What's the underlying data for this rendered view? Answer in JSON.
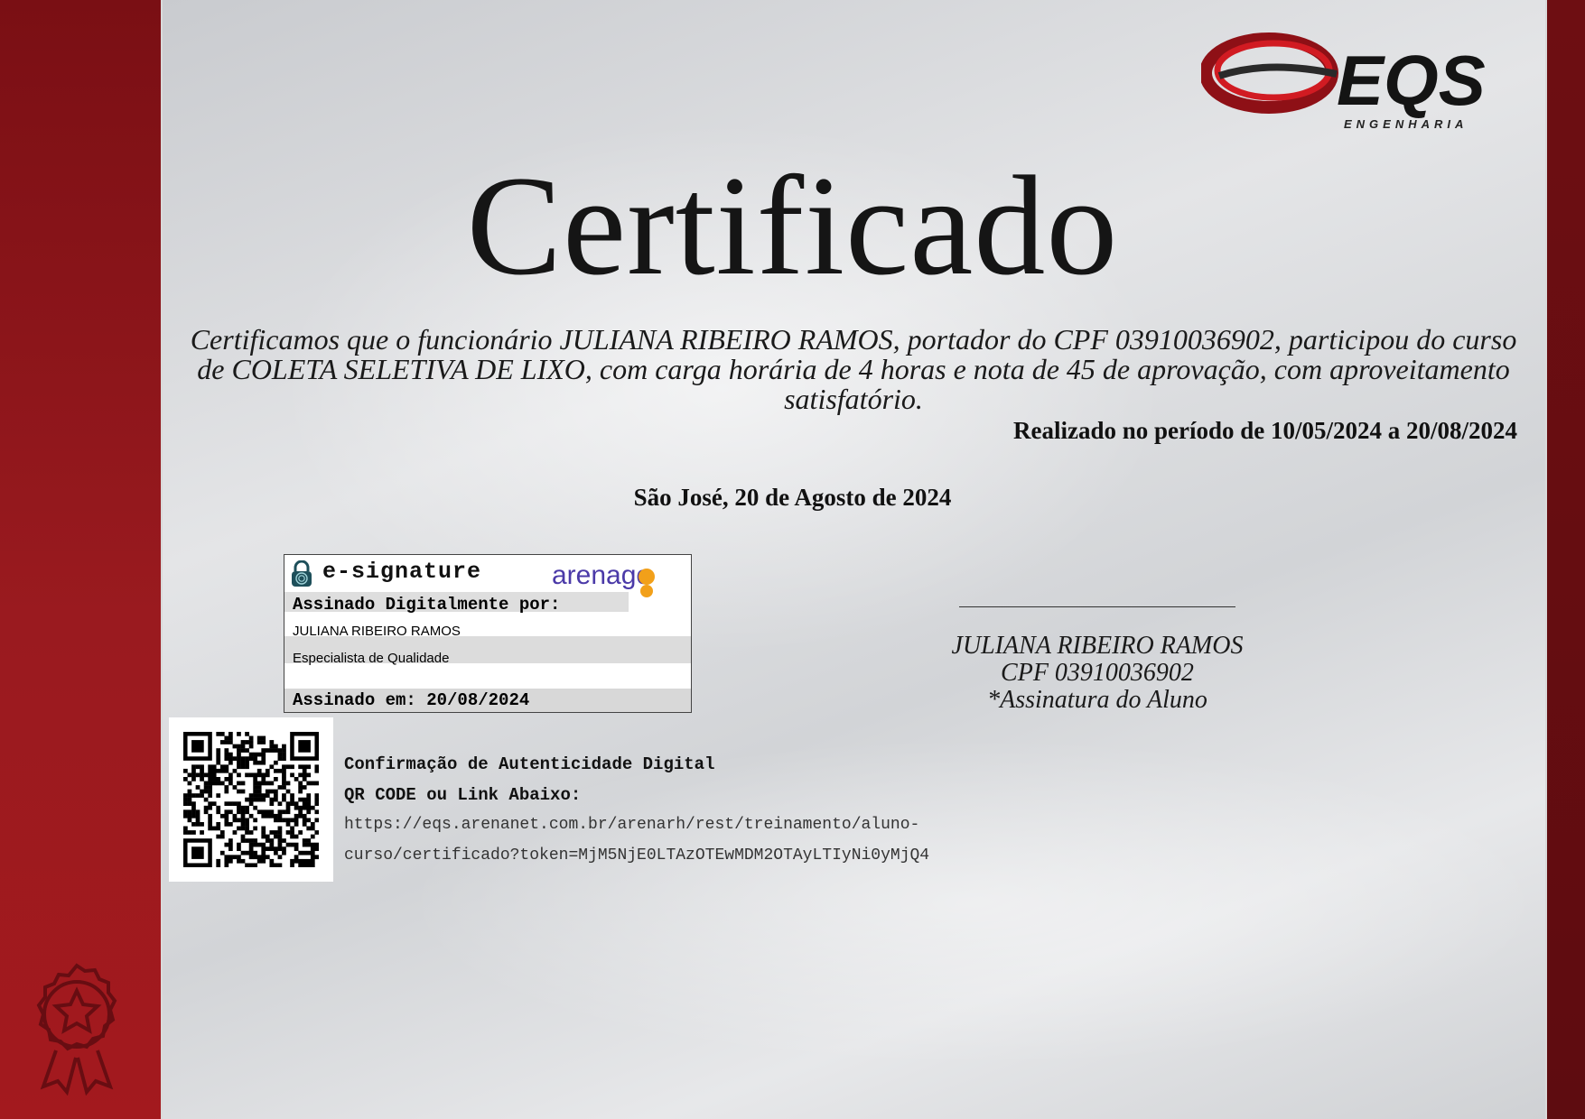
{
  "logo": {
    "brand": "EQS",
    "tagline": "ENGENHARIA"
  },
  "title": "Certificado",
  "body_text": "Certificamos que o funcionário JULIANA RIBEIRO RAMOS, portador  do CPF 03910036902, participou do curso de COLETA SELETIVA DE LIXO, com carga horária de 4 horas e nota de 45 de aprovação, com aproveitamento satisfatório.",
  "period": "Realizado no período de 10/05/2024 a 20/08/2024",
  "place_date": "São José, 20 de Agosto de 2024",
  "esignature": {
    "label": "e-signature",
    "provider_logo": "arenago",
    "signed_by_label": "Assinado Digitalmente por:",
    "signer_name": "JULIANA RIBEIRO RAMOS",
    "signer_role": "Especialista de Qualidade",
    "signed_on": "Assinado em: 20/08/2024",
    "icon": "padlock-fingerprint-icon"
  },
  "verification": {
    "title": "Confirmação de Autenticidade Digital",
    "subtitle": "QR CODE ou Link Abaixo:",
    "url_line_1": "https://eqs.arenanet.com.br/arenarh/rest/treinamento/aluno-",
    "url_line_2": "curso/certificado?token=MjM5NjE0LTAzOTEwMDM2OTAyLTIyNi0yMjQ4"
  },
  "signature": {
    "name": "JULIANA RIBEIRO RAMOS",
    "cpf": "CPF 03910036902",
    "role": "*Assinatura do Aluno"
  },
  "colors": {
    "red_band": "#9a1a1f",
    "dark_band": "#5e0c10",
    "logo_red": "#c8161d",
    "arena_purple": "#4b3aa8",
    "arena_orange": "#f2a01a"
  }
}
